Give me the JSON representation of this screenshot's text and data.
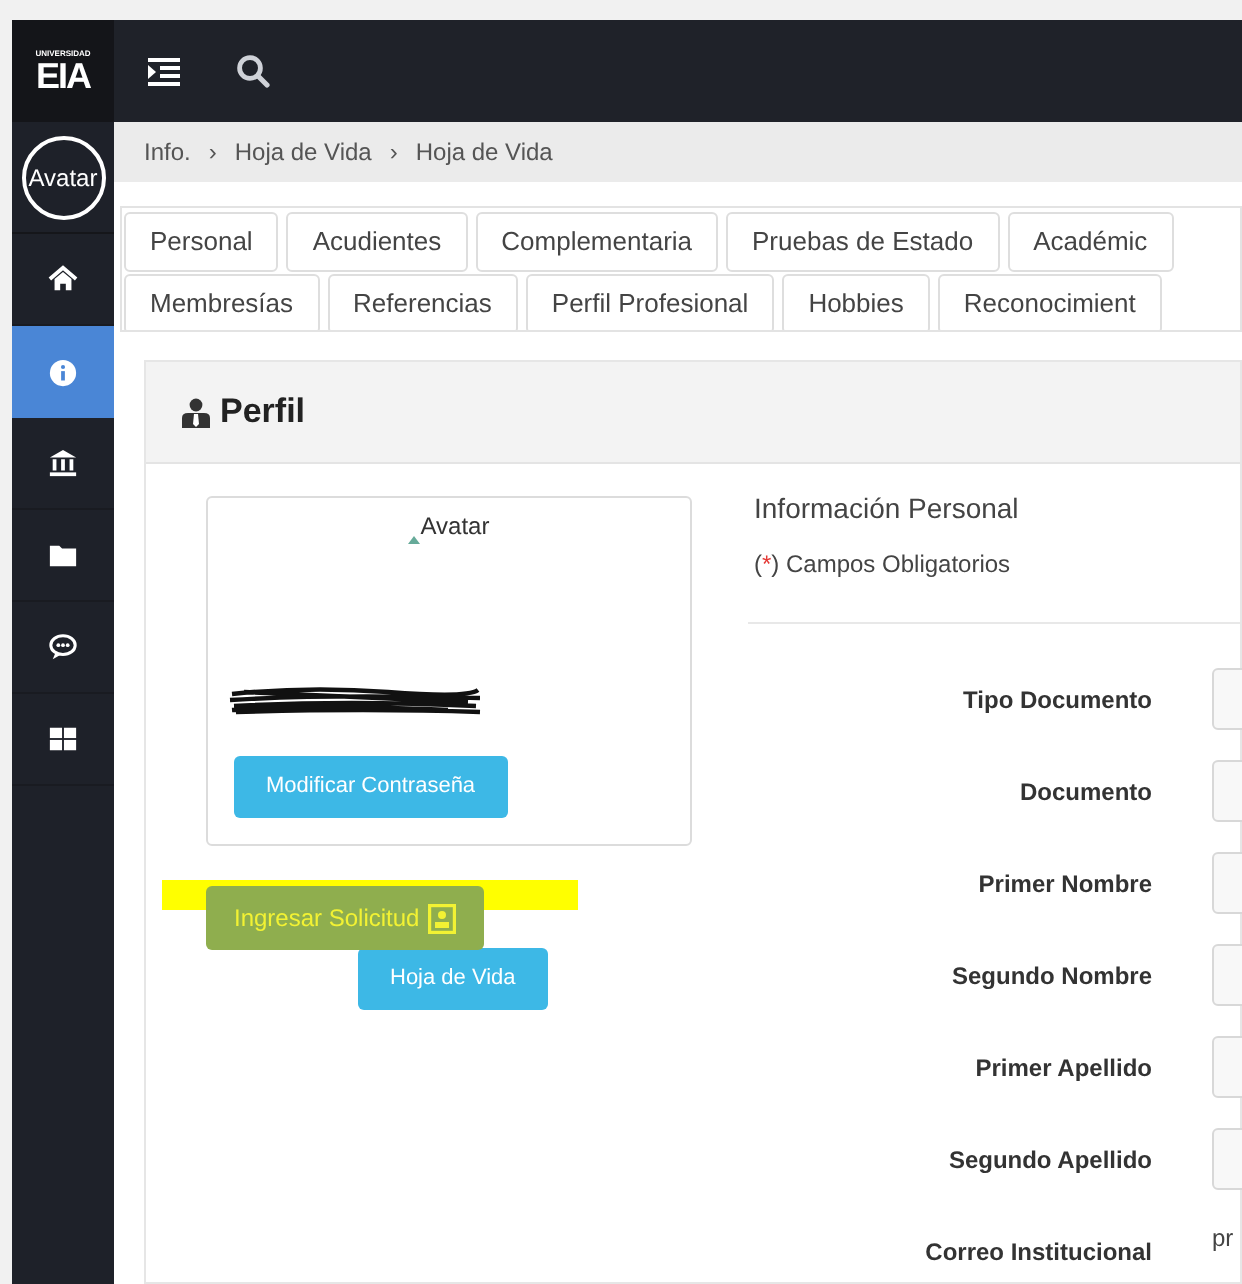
{
  "sidebar": {
    "logo_small": "UNIVERSIDAD",
    "logo": "EIA",
    "avatar_alt": "Avatar",
    "items": [
      {
        "kind": "home",
        "selected": false
      },
      {
        "kind": "info",
        "selected": true
      },
      {
        "kind": "bank",
        "selected": false
      },
      {
        "kind": "folder",
        "selected": false
      },
      {
        "kind": "chat",
        "selected": false
      },
      {
        "kind": "grid",
        "selected": false
      }
    ]
  },
  "breadcrumb": {
    "items": [
      "Info.",
      "Hoja de Vida",
      "Hoja de Vida"
    ],
    "separator": "›"
  },
  "tab_rows": [
    {
      "tabs": [
        {
          "label": "Personal",
          "selected": false
        },
        {
          "label": "Acudientes",
          "selected": false
        },
        {
          "label": "Complementaria",
          "selected": false
        },
        {
          "label": "Pruebas de Estado",
          "selected": false
        },
        {
          "label": "Académic",
          "selected": false
        }
      ]
    },
    {
      "tabs": [
        {
          "label": "Membresías",
          "selected": false
        },
        {
          "label": "Referencias",
          "selected": false
        },
        {
          "label": "Perfil Profesional",
          "selected": false
        },
        {
          "label": "Hobbies",
          "selected": false
        },
        {
          "label": "Reconocimient",
          "selected": false
        }
      ]
    }
  ],
  "card": {
    "title": "Perfil",
    "avatar_alt": "Avatar",
    "password_button": "Modificar Contraseña",
    "request_button": {
      "label": "Ingresar Solicitud",
      "highlighted": true
    },
    "cv_button": "Hoja de Vida"
  },
  "form": {
    "title": "Información Personal",
    "required_note": {
      "before": "(",
      "mark": "*",
      "after": ") Campos Obligatorios"
    },
    "fields": [
      {
        "label": "Tipo Documento"
      },
      {
        "label": "Documento"
      },
      {
        "label": "Primer Nombre"
      },
      {
        "label": "Segundo Nombre"
      },
      {
        "label": "Primer Apellido"
      },
      {
        "label": "Segundo Apellido"
      },
      {
        "label": "Correo Institucional",
        "value": "pr"
      }
    ]
  }
}
